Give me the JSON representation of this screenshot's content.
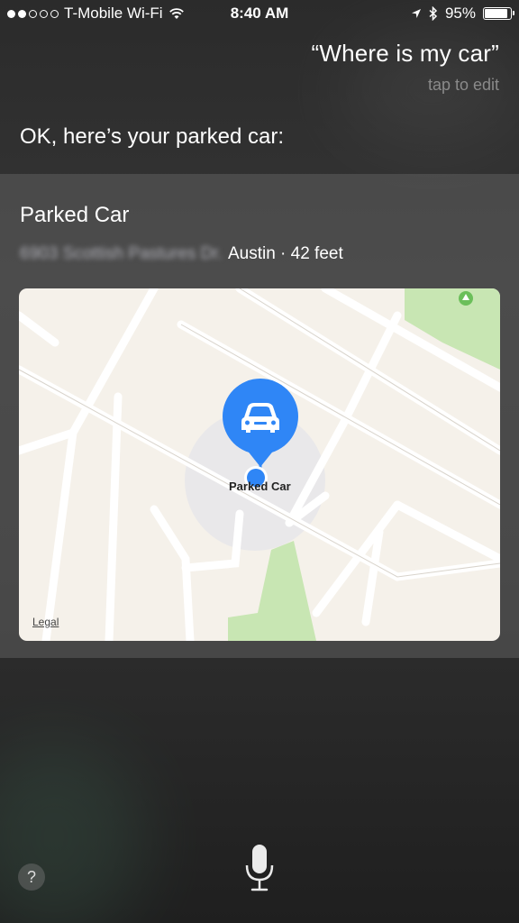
{
  "status_bar": {
    "carrier": "T-Mobile Wi-Fi",
    "time": "8:40 AM",
    "battery": "95%",
    "battery_level": 0.95,
    "signal_bars_filled": 2,
    "signal_bars_total": 5
  },
  "siri": {
    "query": "“Where is my car”",
    "tap_to_edit": "tap to edit",
    "response": "OK, here’s your parked car:"
  },
  "card": {
    "title": "Parked Car",
    "street_blurred": "6903 Scottish Pastures Dr.",
    "city_distance": "Austin · 42 feet",
    "map": {
      "pin_label": "Parked Car",
      "legal": "Legal",
      "pin_icon": "car-icon"
    }
  },
  "bottom": {
    "help": "?",
    "mic_icon": "microphone-icon"
  },
  "colors": {
    "accent_blue": "#2f86f6",
    "map_land": "#f5f1ea",
    "map_park": "#c8e6b3"
  }
}
